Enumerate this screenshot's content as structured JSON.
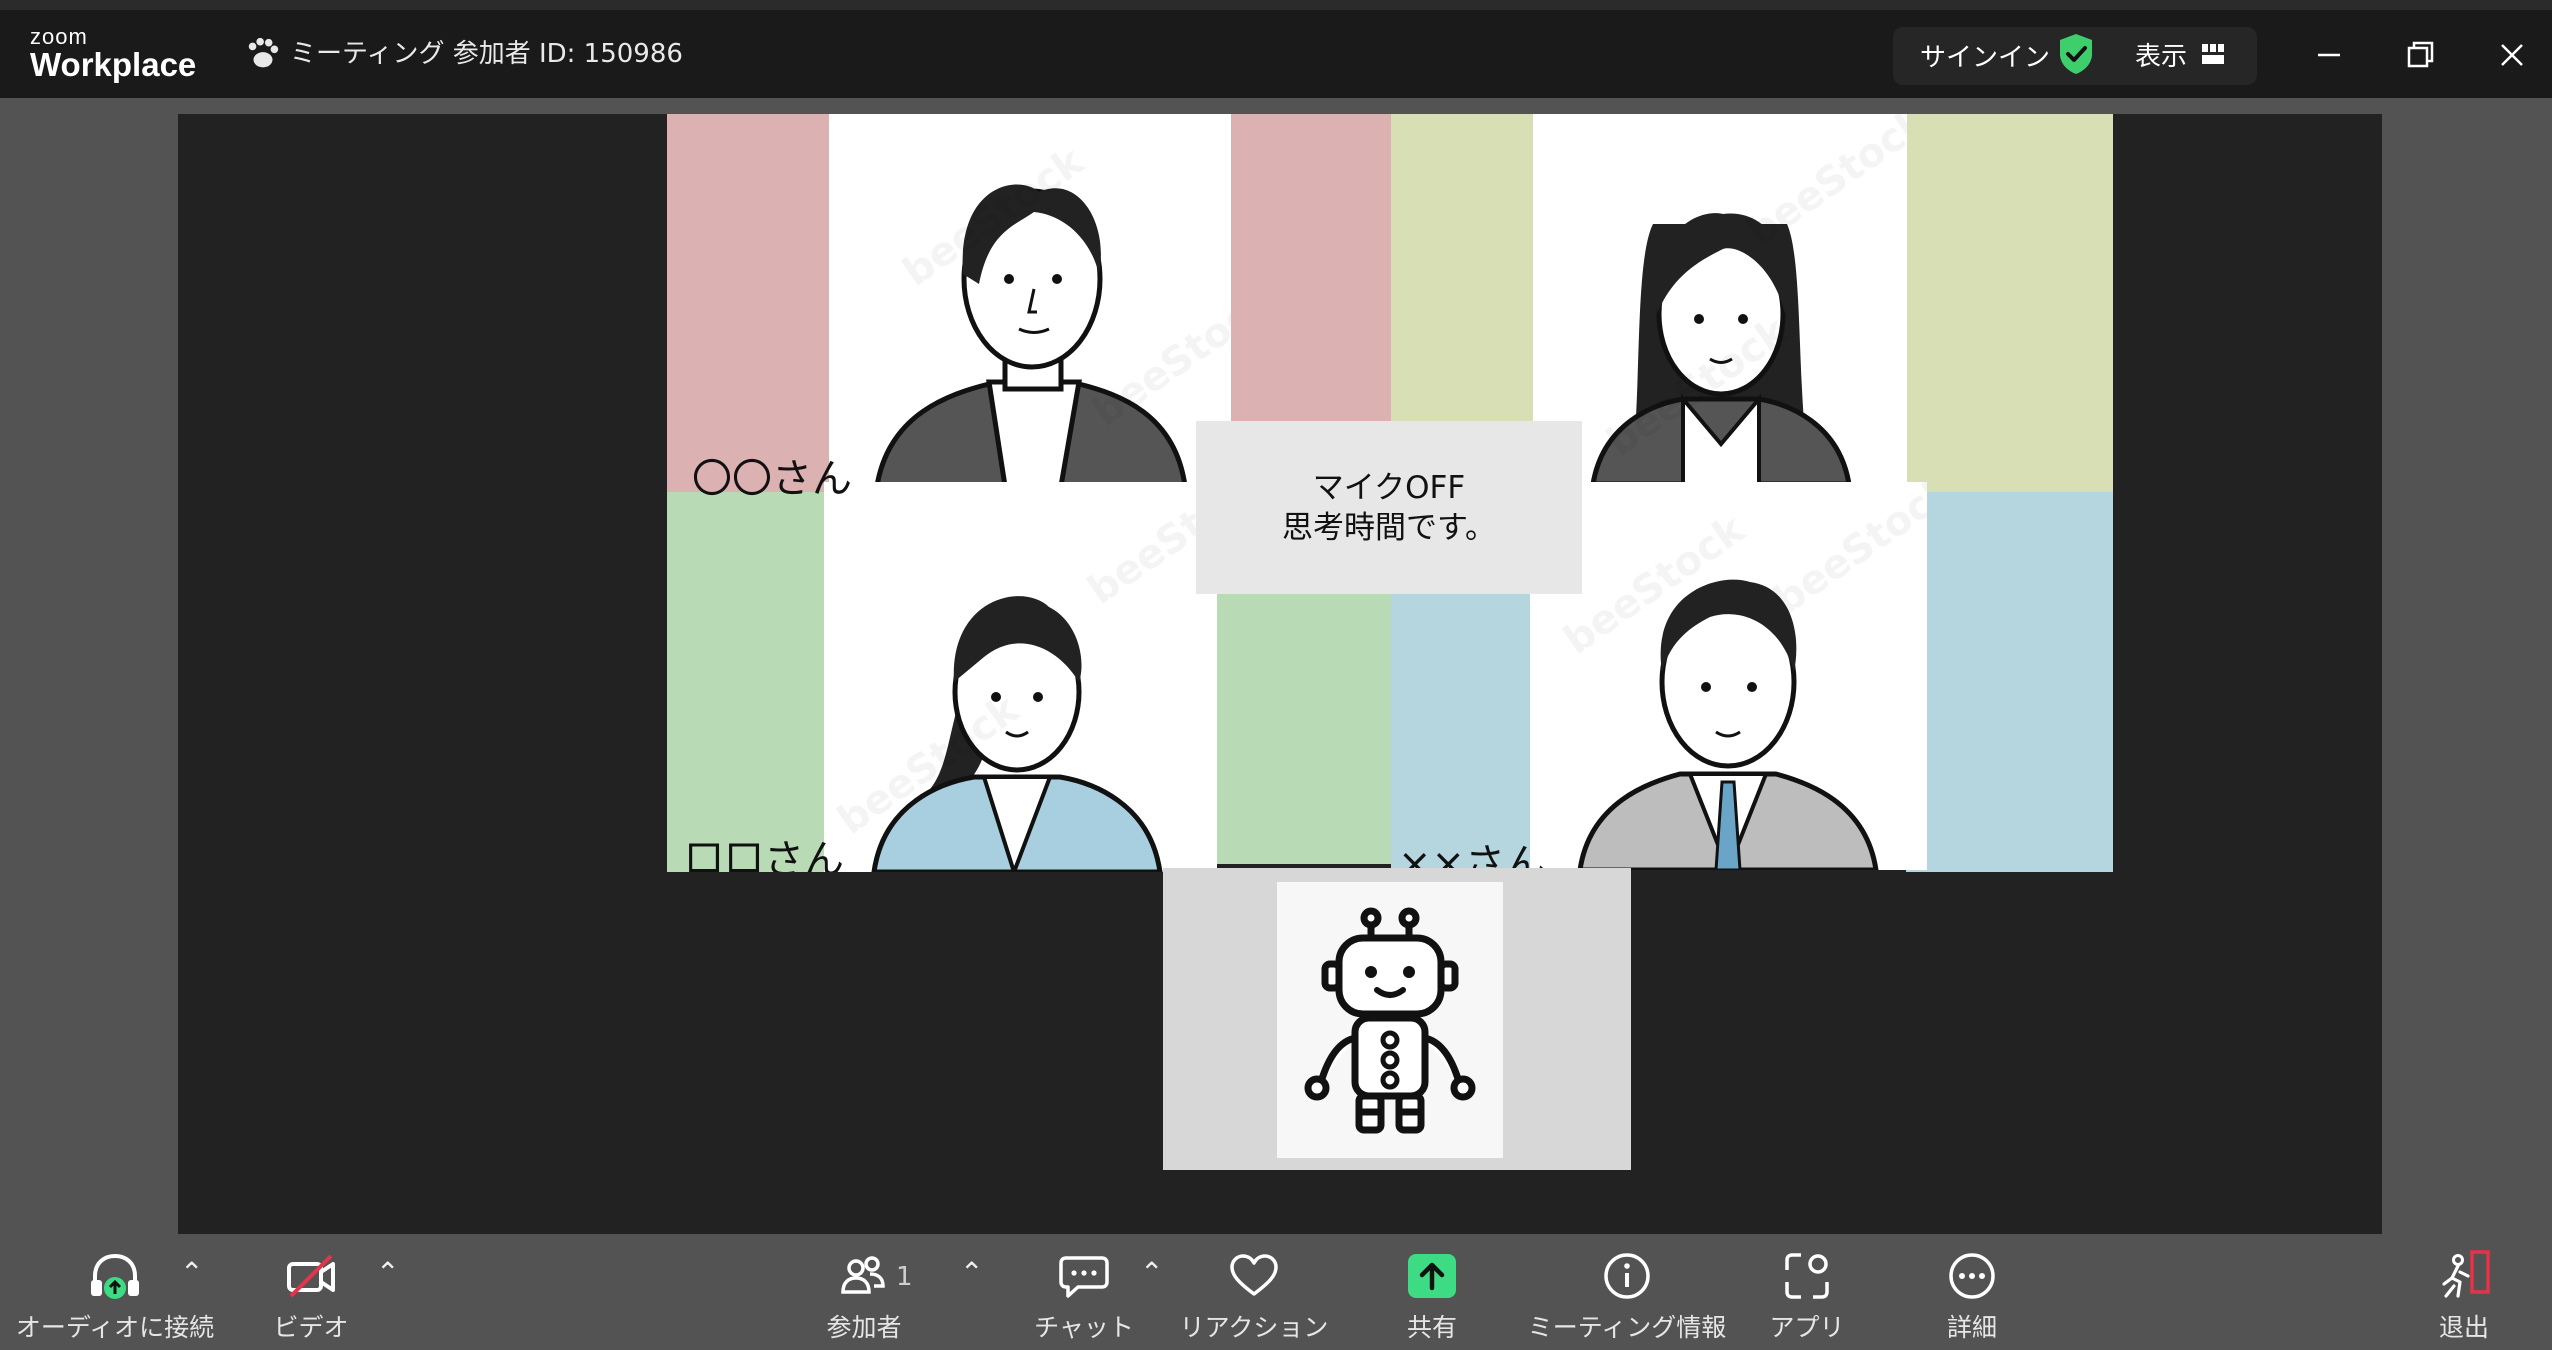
{
  "app": {
    "logo_small": "zoom",
    "logo_large": "Workplace",
    "meeting_title": "ミーティング 参加者 ID: 150986"
  },
  "header": {
    "signin_label": "サインイン",
    "view_label": "表示",
    "shield_color": "#3ecf6c"
  },
  "icons": {
    "paw": "paw-icon",
    "shield": "shield-check-icon",
    "view_grid": "grid-icon",
    "minimize": "minimize-icon",
    "restore": "restore-icon",
    "close": "close-icon"
  },
  "gallery": {
    "participants": [
      {
        "name": "〇〇さん",
        "avatar": "man-with-short-hair"
      },
      {
        "name": "女性",
        "avatar": "woman-with-long-hair",
        "label_visible": false
      },
      {
        "name": "口口さん",
        "avatar": "woman-with-ponytail"
      },
      {
        "name": "××さん",
        "avatar": "man-in-suit"
      }
    ],
    "label_topleft": "〇〇さん",
    "label_bottomleft": "口口さん",
    "label_bottomright": "××さん",
    "notice_line1": "マイクOFF",
    "notice_line2": "思考時間です。",
    "self_avatar": "robot-icon",
    "colors": {
      "pink": "#dcb1b2",
      "lime": "#d8dfb4",
      "green": "#b8dbb5",
      "blue": "#b5d6de"
    }
  },
  "toolbar": {
    "audio_label": "オーディオに接続",
    "video_label": "ビデオ",
    "participants_label": "参加者",
    "participants_count": "1",
    "chat_label": "チャット",
    "reaction_label": "リアクション",
    "share_label": "共有",
    "info_label": "ミーティング情報",
    "apps_label": "アプリ",
    "more_label": "詳細",
    "leave_label": "退出",
    "caret": "⌃",
    "share_color": "#3ddc84",
    "leave_color": "#e5334b"
  }
}
